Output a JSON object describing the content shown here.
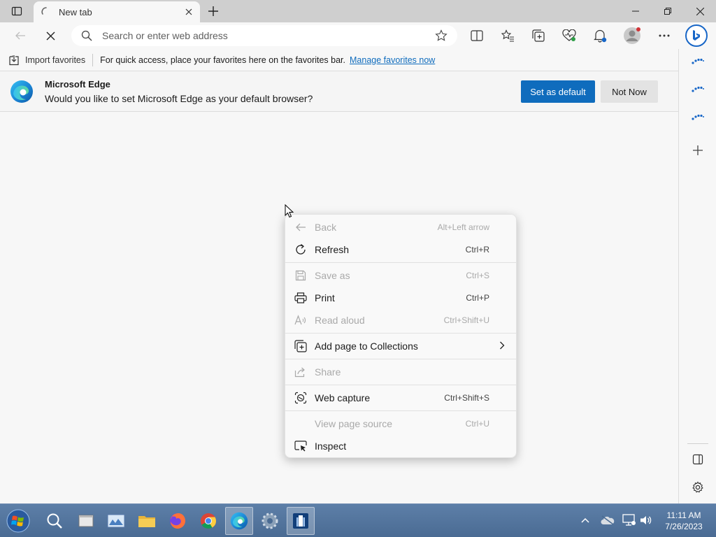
{
  "tab": {
    "title": "New tab"
  },
  "toolbar": {
    "search_placeholder": "Search or enter web address"
  },
  "favbar": {
    "import_label": "Import favorites",
    "message": "For quick access, place your favorites here on the favorites bar.",
    "link": "Manage favorites now"
  },
  "infobar": {
    "title": "Microsoft Edge",
    "message": "Would you like to set Microsoft Edge as your default browser?",
    "primary_button": "Set as default",
    "secondary_button": "Not Now"
  },
  "context_menu": {
    "items": [
      {
        "label": "Back",
        "shortcut": "Alt+Left arrow",
        "enabled": false,
        "icon": "back-arrow-icon"
      },
      {
        "label": "Refresh",
        "shortcut": "Ctrl+R",
        "enabled": true,
        "icon": "refresh-icon"
      },
      {
        "label": "Save as",
        "shortcut": "Ctrl+S",
        "enabled": false,
        "icon": "save-icon"
      },
      {
        "label": "Print",
        "shortcut": "Ctrl+P",
        "enabled": true,
        "icon": "print-icon"
      },
      {
        "label": "Read aloud",
        "shortcut": "Ctrl+Shift+U",
        "enabled": false,
        "icon": "read-aloud-icon"
      },
      {
        "label": "Add page to Collections",
        "shortcut": "",
        "enabled": true,
        "icon": "collections-icon",
        "submenu": true
      },
      {
        "label": "Share",
        "shortcut": "",
        "enabled": false,
        "icon": "share-icon"
      },
      {
        "label": "Web capture",
        "shortcut": "Ctrl+Shift+S",
        "enabled": true,
        "icon": "web-capture-icon"
      },
      {
        "label": "View page source",
        "shortcut": "Ctrl+U",
        "enabled": false,
        "icon": ""
      },
      {
        "label": "Inspect",
        "shortcut": "",
        "enabled": true,
        "icon": "inspect-icon"
      }
    ]
  },
  "taskbar": {
    "time": "11:11 AM",
    "date": "7/26/2023"
  },
  "colors": {
    "accent": "#0f6cbd",
    "taskbar": "#4e6f98"
  }
}
